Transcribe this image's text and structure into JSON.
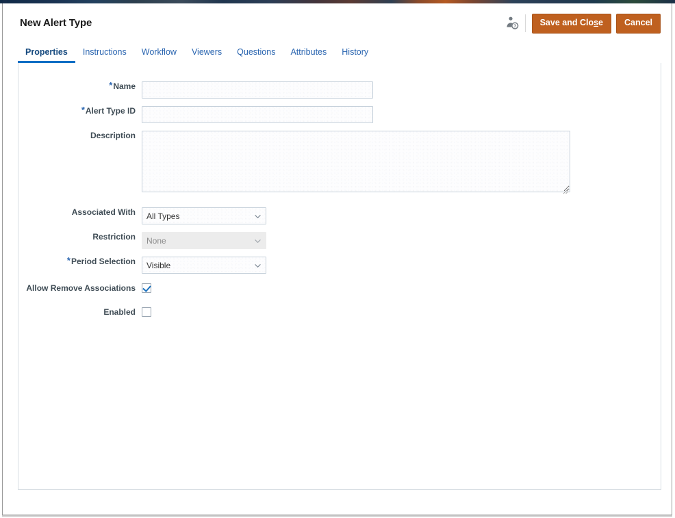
{
  "window": {
    "title": "New Alert Type"
  },
  "header": {
    "title": "New Alert Type",
    "help_icon": "user-help-icon",
    "save_label": "Save and Clo",
    "save_accesskey": "s",
    "save_label_tail": "e",
    "save_full_label": "Save and Close",
    "cancel_label": "Cancel",
    "button_color": "#bf601f"
  },
  "tabs": [
    {
      "label": "Properties",
      "active": true
    },
    {
      "label": "Instructions",
      "active": false
    },
    {
      "label": "Workflow",
      "active": false
    },
    {
      "label": "Viewers",
      "active": false
    },
    {
      "label": "Questions",
      "active": false
    },
    {
      "label": "Attributes",
      "active": false
    },
    {
      "label": "History",
      "active": false
    }
  ],
  "active_tab_color": "#0a6ec4",
  "form": {
    "name": {
      "label": "Name",
      "required": true,
      "value": "",
      "placeholder": ""
    },
    "alert_type_id": {
      "label": "Alert Type ID",
      "required": true,
      "value": "",
      "placeholder": ""
    },
    "description": {
      "label": "Description",
      "required": false,
      "value": "",
      "placeholder": ""
    },
    "associated_with": {
      "label": "Associated With",
      "required": false,
      "value": "All Types",
      "disabled": false,
      "options": [
        "All Types"
      ]
    },
    "restriction": {
      "label": "Restriction",
      "required": false,
      "value": "None",
      "disabled": true,
      "options": [
        "None"
      ]
    },
    "period_selection": {
      "label": "Period Selection",
      "required": true,
      "value": "Visible",
      "disabled": false,
      "options": [
        "Visible"
      ]
    },
    "allow_remove_associations": {
      "label": "Allow Remove Associations",
      "checked": true
    },
    "enabled": {
      "label": "Enabled",
      "checked": false
    }
  }
}
